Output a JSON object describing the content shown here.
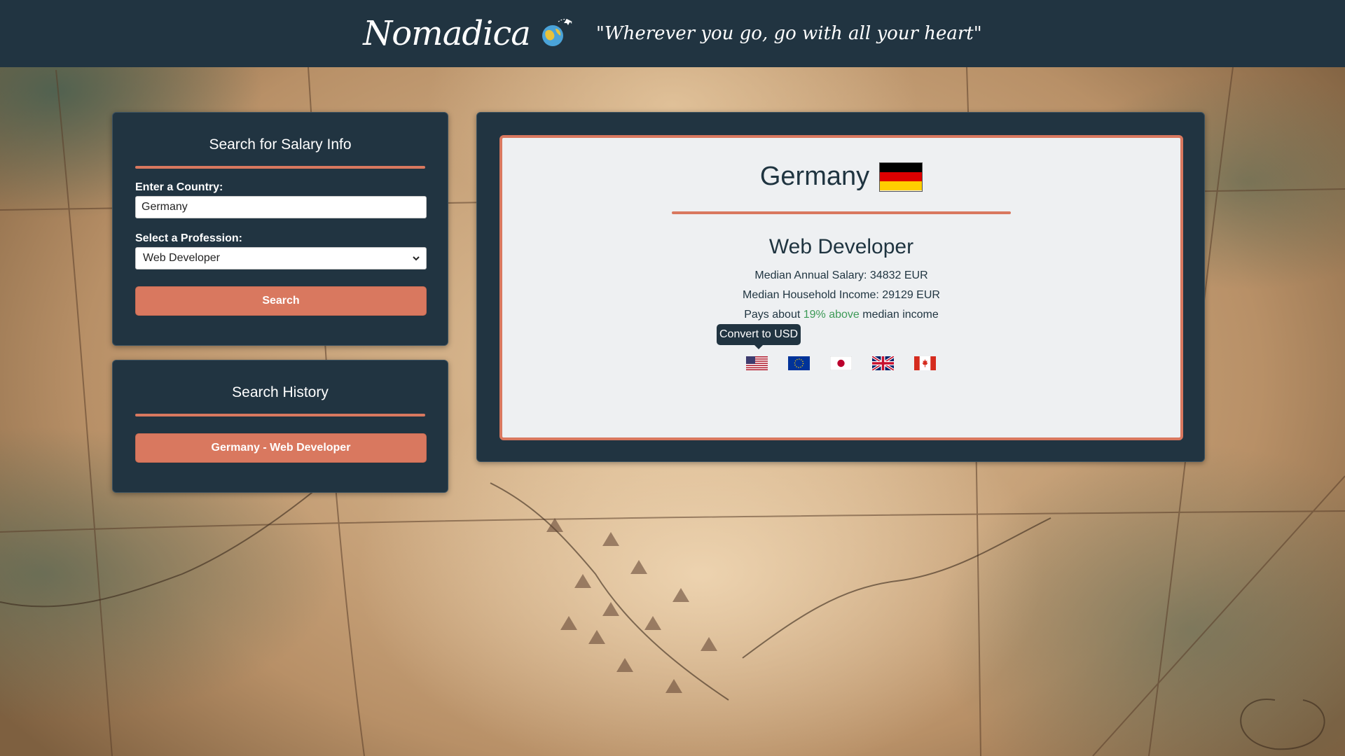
{
  "header": {
    "brand": "Nomadica",
    "tagline": "\"Wherever you go, go with all your heart\""
  },
  "search_panel": {
    "title": "Search for Salary Info",
    "country_label": "Enter a Country:",
    "country_value": "Germany",
    "profession_label": "Select a Profession:",
    "profession_selected": "Web Developer",
    "search_button": "Search"
  },
  "history_panel": {
    "title": "Search History",
    "items": [
      {
        "label": "Germany - Web Developer"
      }
    ]
  },
  "result": {
    "country": "Germany",
    "profession": "Web Developer",
    "median_salary": "Median Annual Salary: 34832 EUR",
    "median_household": "Median Household Income: 29129 EUR",
    "pays_prefix": "Pays about",
    "pays_highlight": "19% above",
    "pays_suffix": "median income",
    "tooltip": "Convert to USD",
    "currency_flags": [
      {
        "icon": "us-flag-icon",
        "currency": "USD"
      },
      {
        "icon": "eu-flag-icon",
        "currency": "EUR"
      },
      {
        "icon": "japan-flag-icon",
        "currency": "JPY"
      },
      {
        "icon": "uk-flag-icon",
        "currency": "GBP"
      },
      {
        "icon": "canada-flag-icon",
        "currency": "CAD"
      }
    ]
  },
  "colors": {
    "navy": "#213441",
    "accent": "#d9785f",
    "card": "#eef0f2",
    "positive": "#3d9a57"
  }
}
